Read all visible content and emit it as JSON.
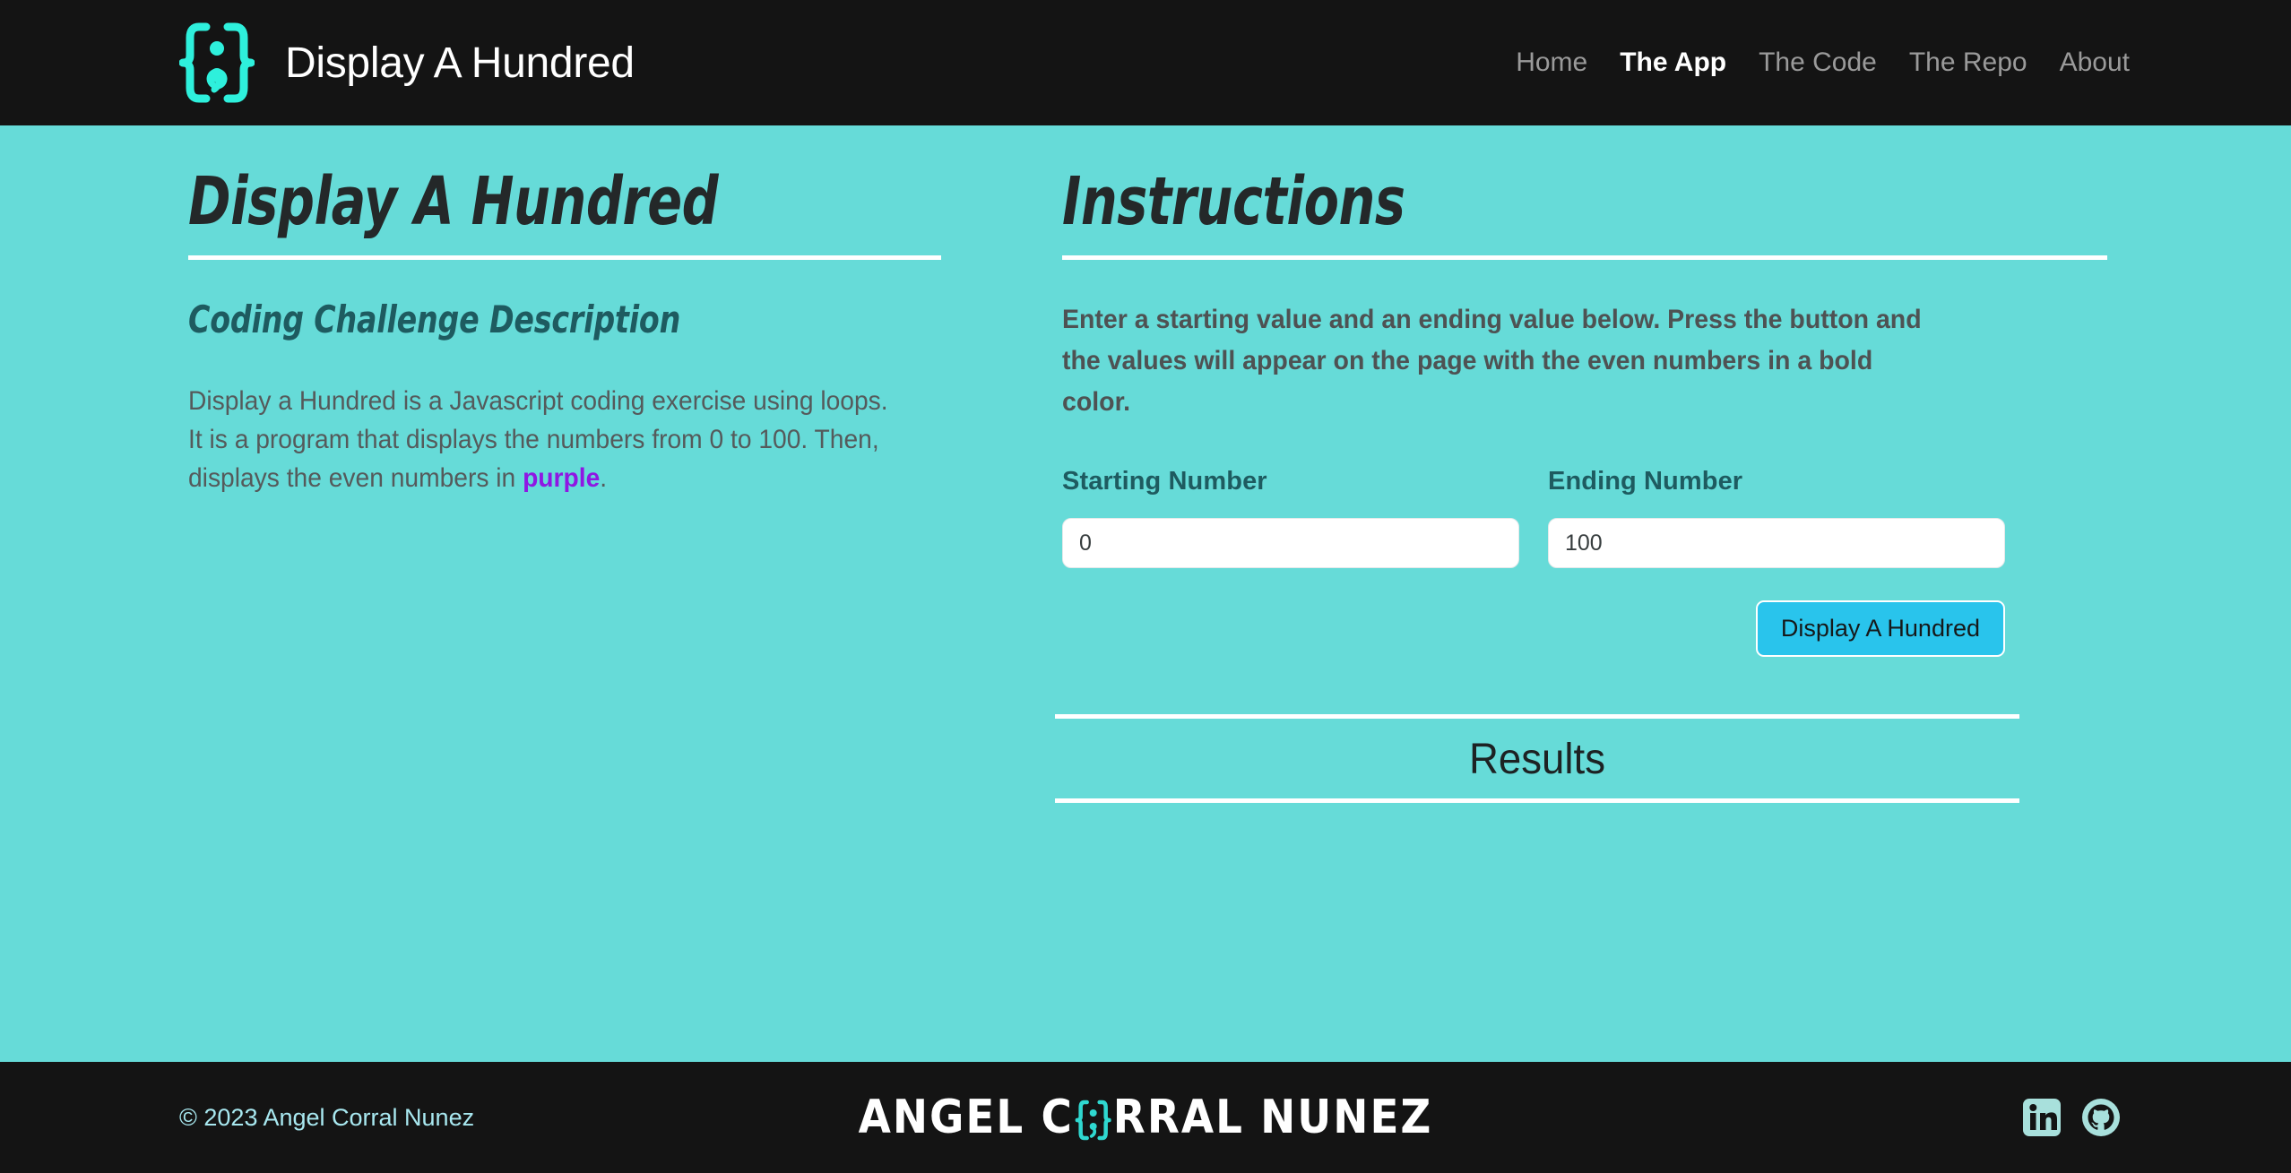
{
  "header": {
    "logo_icon": "braces-semicolon-logo-icon",
    "title": "Display A Hundred",
    "nav": [
      {
        "label": "Home",
        "active": false
      },
      {
        "label": "The App",
        "active": true
      },
      {
        "label": "The Code",
        "active": false
      },
      {
        "label": "The Repo",
        "active": false
      },
      {
        "label": "About",
        "active": false
      }
    ]
  },
  "left": {
    "heading": "Display A Hundred",
    "subheading": "Coding Challenge Description",
    "description_before": "Display a Hundred is a Javascript coding exercise using loops. It is a program that displays the numbers from 0 to 100. Then, displays the even numbers in ",
    "description_highlight": "purple",
    "description_after": "."
  },
  "right": {
    "heading": "Instructions",
    "instructions": "Enter a starting value and an ending value below. Press the button and the values will appear on the page with the even numbers in a bold color.",
    "form": {
      "start_label": "Starting Number",
      "start_value": "0",
      "start_placeholder": "Starting Number",
      "end_label": "Ending Number",
      "end_value": "100",
      "end_placeholder": "Ending Number",
      "submit_label": "Display A Hundred"
    },
    "results": {
      "title": "Results",
      "output": ""
    }
  },
  "footer": {
    "copyright": "© 2023 Angel Corral Nunez",
    "wordmark_before": "ANGEL C",
    "wordmark_mark_icon": "braces-semicolon-logo-icon",
    "wordmark_after": "RRAL NUNEZ",
    "socials": [
      {
        "name": "linkedin-icon"
      },
      {
        "name": "github-icon"
      }
    ]
  },
  "colors": {
    "background": "#66dbd8",
    "dark": "#141414",
    "accent_cyan": "#2ef0dc",
    "button": "#29c4ec",
    "purple": "#8f17e3",
    "teal_text": "#1e5b60",
    "footer_link": "#a8e8f0",
    "social_icon": "#a8e0dc"
  }
}
